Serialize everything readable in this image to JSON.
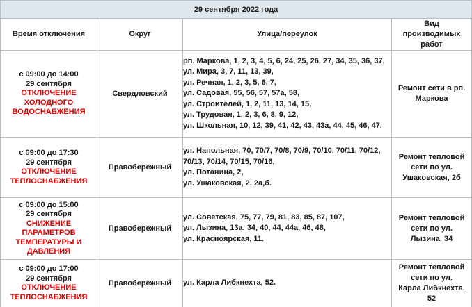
{
  "date_header": "29 сентября 2022 года",
  "columns": {
    "time": "Время отключения",
    "district": "Округ",
    "street": "Улица/переулок",
    "work_lines": [
      "Вид",
      "производимых",
      "работ"
    ]
  },
  "rows": [
    {
      "time_range": "с 09:00 до 14:00",
      "date": "29 сентября",
      "event_lines": [
        "ОТКЛЮЧЕНИЕ",
        "ХОЛОДНОГО",
        "ВОДОСНАБЖЕНИЯ"
      ],
      "district": "Свердловский",
      "streets": [
        "рп. Маркова, 1, 2, 3, 4, 5, 6, 24, 25, 26, 27, 34, 35, 36, 37,",
        "ул. Мира, 3, 7, 11, 13, 39,",
        "ул. Речная, 1, 2, 3, 5, 6, 7,",
        "ул. Садовая, 55, 56, 57, 57а, 58,",
        "ул. Строителей, 1, 2, 11, 13, 14, 15,",
        "ул. Трудовая, 1, 2, 3, 6, 8, 9, 12,",
        "ул. Школьная, 10, 12, 39, 41, 42, 43, 43а, 44, 45, 46, 47."
      ],
      "work_lines": [
        "Ремонт сети в рп.",
        "Маркова"
      ]
    },
    {
      "time_range": "с 09:00 до 17:30",
      "date": "29 сентября",
      "event_lines": [
        "ОТКЛЮЧЕНИЕ",
        "ТЕПЛОСНАБЖЕНИЯ"
      ],
      "district": "Правобережный",
      "streets": [
        "ул. Напольная, 70, 70/7, 70/8, 70/9, 70/10, 70/11, 70/12,",
        "70/13, 70/14, 70/15, 70/16,",
        "ул. Потанина, 2,",
        "ул. Ушаковская, 2, 2а,б."
      ],
      "work_lines": [
        "Ремонт тепловой",
        "сети по ул.",
        "Ушаковская, 2б"
      ]
    },
    {
      "time_range": "с 09:00 до 15:00",
      "date": "29 сентября",
      "event_lines": [
        "СНИЖЕНИЕ",
        "ПАРАМЕТРОВ",
        "ТЕМПЕРАТУРЫ И",
        "ДАВЛЕНИЯ"
      ],
      "district": "Правобережный",
      "streets": [
        "ул. Советская, 75, 77, 79, 81, 83, 85, 87, 107,",
        "ул. Лызина, 13а, 34, 40, 44, 44а, 46, 48,",
        "ул. Красноярская, 11."
      ],
      "work_lines": [
        "Ремонт тепловой",
        "сети по ул.",
        "Лызина, 34"
      ]
    },
    {
      "time_range": "с 09:00 до 17:00",
      "date": "29 сентября",
      "event_lines": [
        "ОТКЛЮЧЕНИЕ",
        "ТЕПЛОСНАБЖЕНИЯ"
      ],
      "district": "Правобережный",
      "streets": [
        "ул. Карла Либкнехта, 52."
      ],
      "work_lines": [
        "Ремонт тепловой",
        "сети по ул.",
        "Карла Либкнехта,",
        "52"
      ]
    }
  ]
}
